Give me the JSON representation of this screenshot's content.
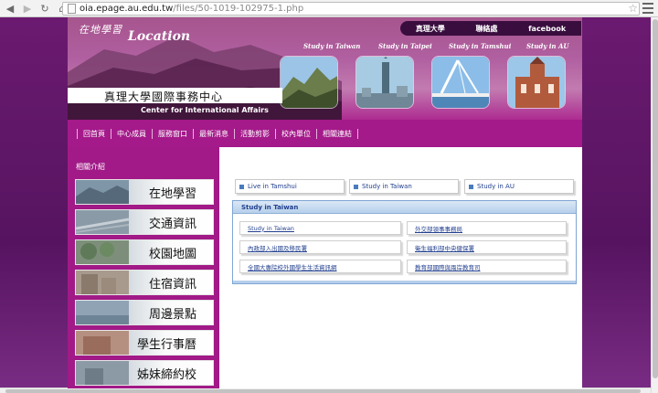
{
  "browser": {
    "url_host": "oia.epage.au.edu.tw",
    "url_path": "/files/50-1019-102975-1.php"
  },
  "header": {
    "logo_script": "在地學習",
    "logo_location": "Location",
    "top_links": [
      "真理大學",
      "聯絡處",
      "facebook"
    ],
    "study_labels": [
      "Study in Taiwan",
      "Study in Taipei",
      "Study in Tamshui",
      "Study in AU"
    ],
    "center_cn": "真理大學國際事務中心",
    "center_en": "Center for International Affairs"
  },
  "nav": [
    "回首頁",
    "中心成員",
    "服務窗口",
    "最新消息",
    "活動剪影",
    "校內單位",
    "相關連結"
  ],
  "sidebar": {
    "title": "相關介紹",
    "items": [
      "在地學習",
      "交通資訊",
      "校園地圖",
      "住宿資訊",
      "周邊景點",
      "學生行事曆",
      "姊妹締約校"
    ]
  },
  "main": {
    "tabs": [
      "Live in Tamshui",
      "Study in Taiwan",
      "Study in AU"
    ],
    "panel_title": "Study in Taiwan",
    "links": [
      "Study in Taiwan",
      "外交部領事事務局",
      "內政部入出國及移民署",
      "衛生福利部中央健保署",
      "全國大專院校外國學生生活資訊網",
      "教育部國際與兩岸教育司"
    ]
  }
}
